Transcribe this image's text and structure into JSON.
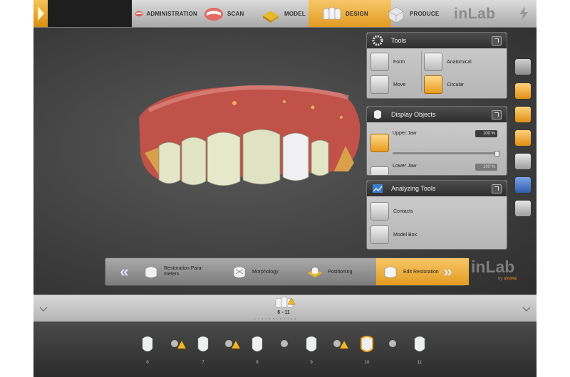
{
  "nav": {
    "steps": [
      {
        "label": "ADMINISTRATION",
        "active": false
      },
      {
        "label": "SCAN",
        "active": false
      },
      {
        "label": "MODEL",
        "active": false
      },
      {
        "label": "DESIGN",
        "active": true
      },
      {
        "label": "PRODUCE",
        "active": false
      }
    ],
    "brand": "inLab"
  },
  "panels": {
    "tools": {
      "title": "Tools",
      "items": [
        {
          "label": "Form"
        },
        {
          "label": "Anatomical"
        },
        {
          "label": "Move"
        },
        {
          "label": "Circular"
        }
      ]
    },
    "display": {
      "title": "Display Objects",
      "items": [
        {
          "label": "Upper Jaw",
          "value": "100 %"
        },
        {
          "label": "Lower Jaw",
          "value": "100 %"
        }
      ]
    },
    "analyzing": {
      "title": "Analyzing Tools",
      "items": [
        {
          "label": "Contacts"
        },
        {
          "label": "Model Box"
        }
      ]
    }
  },
  "wizard": {
    "steps": [
      {
        "label": "Restoration Parameters",
        "line1": "Restoration Para-",
        "line2": "meters"
      },
      {
        "label": "Morphology"
      },
      {
        "label": "Positioning"
      },
      {
        "label": "Edit Restoration"
      }
    ],
    "prev": "«",
    "next": "»",
    "brand": "inLab",
    "by": "by",
    "maker": "sirona"
  },
  "strip": {
    "selection": "6 - 11"
  },
  "teeth": {
    "numbers": [
      "6",
      "7",
      "8",
      "9",
      "10",
      "11"
    ]
  },
  "colors": {
    "accent": "#e39b21",
    "panel": "#c2c2c2",
    "viewport": "#3a3a3a"
  }
}
